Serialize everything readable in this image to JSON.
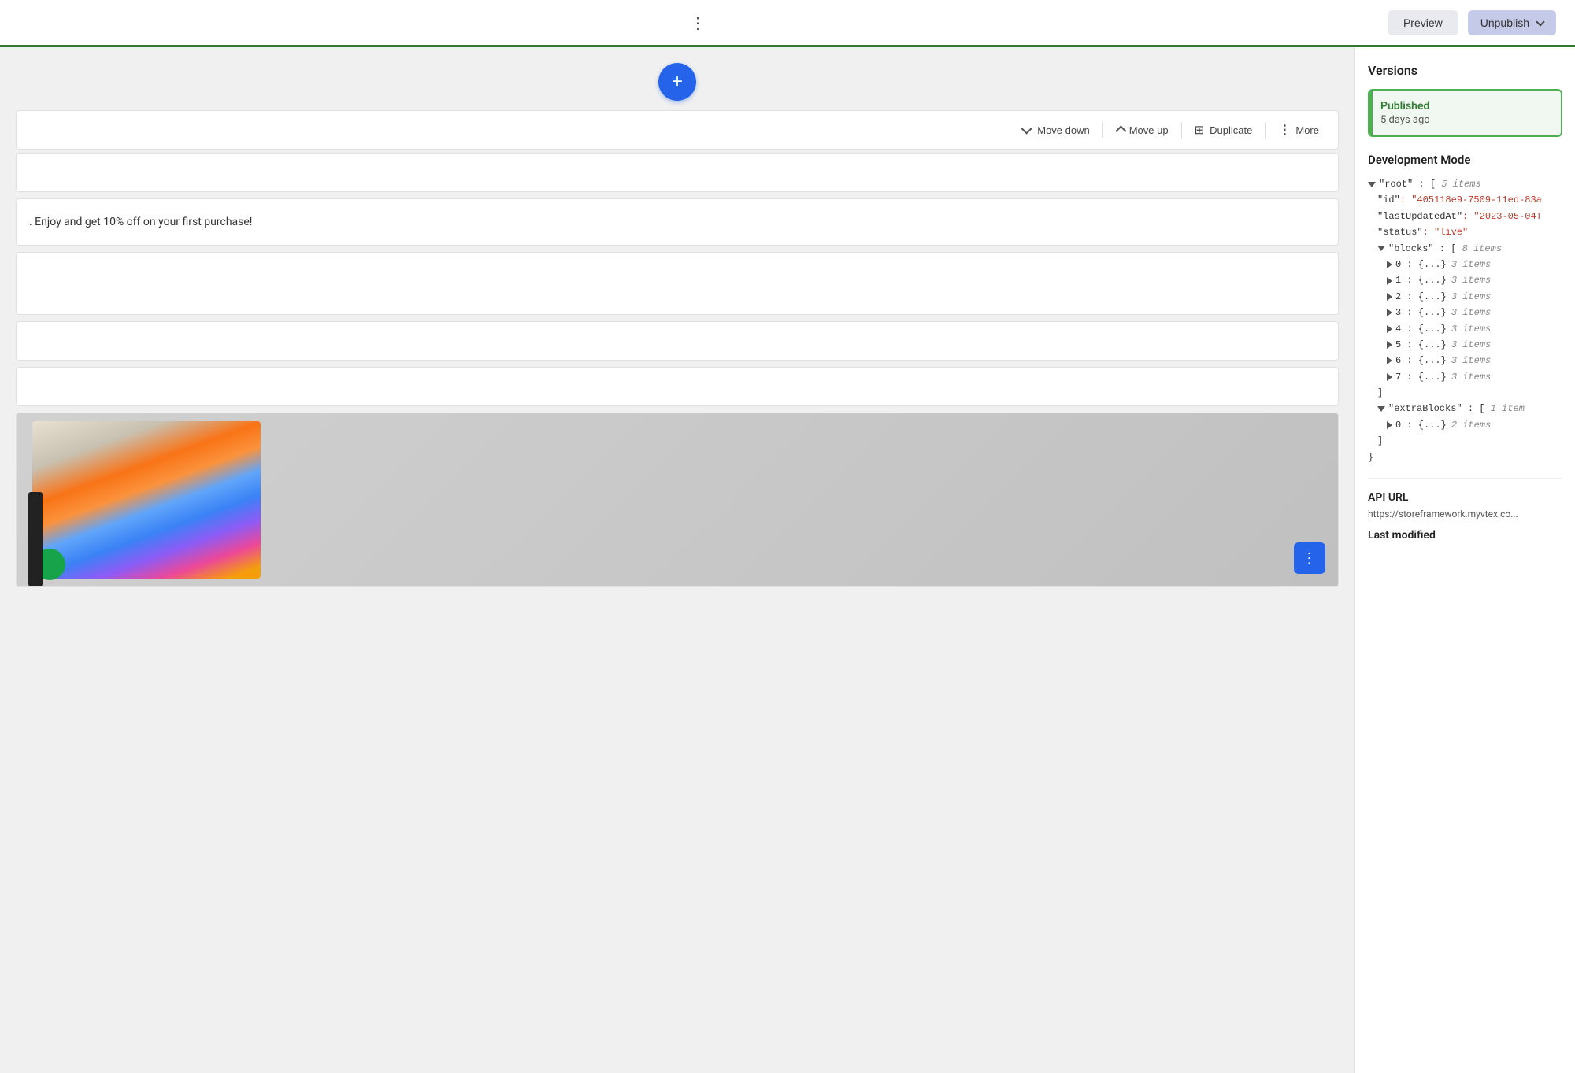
{
  "topbar": {
    "dots_label": "⋮",
    "preview_label": "Preview",
    "unpublish_label": "Unpublish",
    "unpublish_chevron": "▾",
    "progress_bar_color": "#2d7a2d"
  },
  "toolbar": {
    "move_down_label": "Move down",
    "move_up_label": "Move up",
    "duplicate_label": "Duplicate",
    "more_label": "More"
  },
  "blocks": {
    "text_content": ". Enjoy and get 10% off on your first purchase!"
  },
  "add_button": {
    "label": "+"
  },
  "float_button": {
    "dots": "⋮"
  },
  "sidebar": {
    "versions_title": "Versions",
    "version_status": "Published",
    "version_time": "5 days ago",
    "dev_mode_title": "Development Mode",
    "json_tree": {
      "root_key": "\"root\"",
      "root_bracket": ": [",
      "root_comment": "5 items",
      "id_key": "\"id\"",
      "id_value": ": \"405118e9-7509-11ed-83a",
      "lastUpdatedAt_key": "\"lastUpdatedAt\"",
      "lastUpdatedAt_value": ": \"2023-05-04T",
      "status_key": "\"status\"",
      "status_value": ": \"live\"",
      "blocks_key": "\"blocks\"",
      "blocks_bracket": ": [",
      "blocks_comment": "8 items",
      "block0": "0 : {...}",
      "block0_comment": "3 items",
      "block1": "1 : {...}",
      "block1_comment": "3 items",
      "block2": "2 : {...}",
      "block2_comment": "3 items",
      "block3": "3 : {...}",
      "block3_comment": "3 items",
      "block4": "4 : {...}",
      "block4_comment": "3 items",
      "block5": "5 : {...}",
      "block5_comment": "3 items",
      "block6": "6 : {...}",
      "block6_comment": "3 items",
      "block7": "7 : {...}",
      "block7_comment": "3 items",
      "close_bracket_1": "]",
      "extrablocks_key": "\"extraBlocks\"",
      "extrablocks_bracket": ": [",
      "extrablocks_comment": "1 item",
      "extrablock0": "0 : {...}",
      "extrablock0_comment": "2 items",
      "close_bracket_2": "]",
      "close_brace": "}"
    },
    "api_url_title": "API URL",
    "api_url_value": "https://storeframework.myvtex.co...",
    "last_modified_title": "Last modified"
  }
}
